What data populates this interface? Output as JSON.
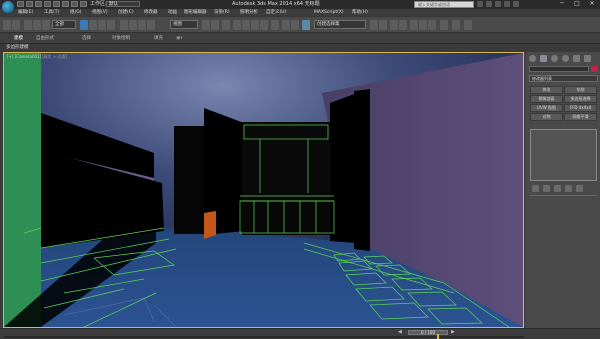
{
  "title_bar": {
    "workspace_label": "工作区:",
    "workspace_value": "默认",
    "app_title": "Autodesk 3ds Max 2014 x64    无标题",
    "search_placeholder": "键入关键字或短语",
    "min_glyph": "─",
    "max_glyph": "□",
    "close_glyph": "✕"
  },
  "menu": {
    "items": [
      "编辑(E)",
      "工具(T)",
      "组(G)",
      "视图(V)",
      "创建(C)",
      "修改器",
      "动画",
      "图形编辑器",
      "渲染(R)",
      "照明分析",
      "自定义(U)",
      "MAXScript(X)",
      "帮助(H)"
    ]
  },
  "toolbar": {
    "selection_filter": "全部",
    "view_dropdown": "视图",
    "named_selection": "创建选择集"
  },
  "ribbon": {
    "tabs": [
      "建模",
      "自由形式",
      "选择",
      "对象绘制",
      "填充"
    ],
    "active_tab": "建模",
    "sub_label": "多边形建模"
  },
  "viewport": {
    "label": "[+] [Camera001]",
    "label_secondary": "[真实 + 边面]",
    "border_color": "#d8b64b"
  },
  "command_panel": {
    "modifier_list": "修改器列表",
    "buttons": [
      "挤出",
      "车削",
      "倒角剖面",
      "多边形选择",
      "UVW 贴图",
      "FFD 4x4x4",
      "对称",
      "网格平滑"
    ],
    "accent_color": "#c0234a"
  },
  "status": {
    "frame_counter": "0 / 100",
    "prev_glyph": "◀",
    "next_glyph": "▶"
  }
}
